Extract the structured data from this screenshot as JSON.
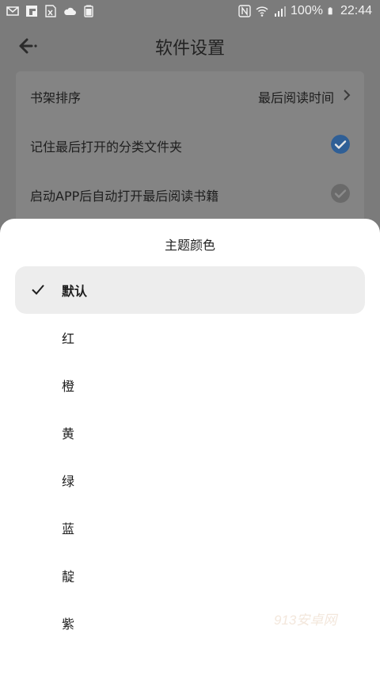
{
  "status_bar": {
    "battery": "100%",
    "time": "22:44",
    "left_icons": [
      "gmail-icon",
      "flipboard-icon",
      "excel-icon",
      "cloud-icon",
      "battery-100-icon"
    ],
    "right_icons": [
      "nfc-icon",
      "wifi-icon",
      "signal-icon",
      "battery-icon"
    ]
  },
  "page": {
    "title": "软件设置",
    "back_icon": "back-arrow-icon",
    "rows": [
      {
        "label": "书架排序",
        "value": "最后阅读时间"
      },
      {
        "label": "记住最后打开的分类文件夹",
        "checked": true
      },
      {
        "label": "启动APP后自动打开最后阅读书籍",
        "checked": false
      }
    ]
  },
  "sheet": {
    "title": "主题颜色",
    "options": [
      "默认",
      "红",
      "橙",
      "黄",
      "绿",
      "蓝",
      "靛",
      "紫"
    ],
    "selected_index": 0
  },
  "watermark": "913安卓网",
  "colors": {
    "accent": "#2f6fb8",
    "dim_overlay": "#7b7b7b",
    "sheet_bg": "#ffffff",
    "selected_bg": "#ededed"
  }
}
